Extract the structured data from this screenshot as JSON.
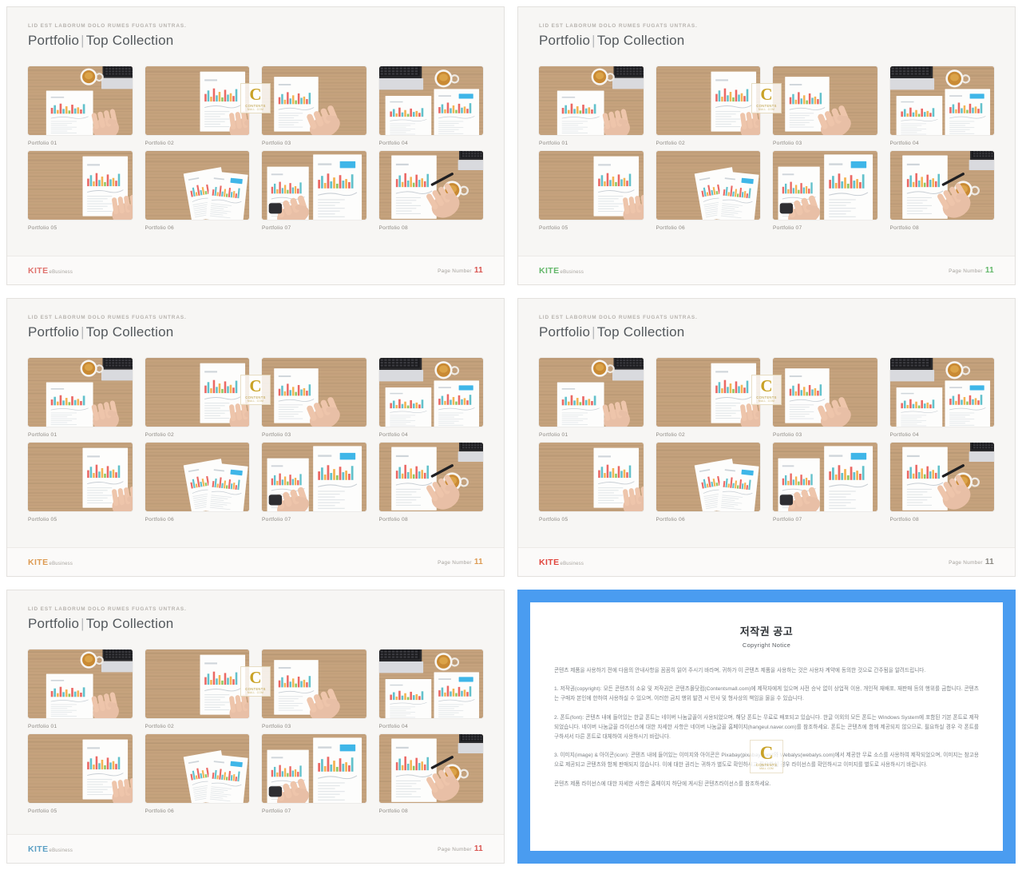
{
  "slides": [
    {
      "eyebrow": "LID EST LABORUM  DOLO RUMES FUGATS  UNTRAS.",
      "title_a": "Portfolio",
      "title_bar": "|",
      "title_b": "Top Collection",
      "logo_main": "KITE",
      "logo_sub": "eBusiness",
      "logo_color": "#e0736e",
      "page_label": "Page Number",
      "page_value": "11",
      "page_value_color": "#d9534f",
      "thumbs": [
        {
          "label": "Portfolio 01",
          "scene": "laptop-coffee-hand"
        },
        {
          "label": "Portfolio 02",
          "scene": "paper-hand-right"
        },
        {
          "label": "Portfolio 03",
          "scene": "paper-hand-point"
        },
        {
          "label": "Portfolio 04",
          "scene": "laptop-coffee-two-docs"
        },
        {
          "label": "Portfolio 05",
          "scene": "paper-hand-right"
        },
        {
          "label": "Portfolio 06",
          "scene": "two-docs-diagonal"
        },
        {
          "label": "Portfolio 07",
          "scene": "hand-watch-two-docs"
        },
        {
          "label": "Portfolio 08",
          "scene": "pen-hand-coffee-laptop"
        }
      ]
    },
    {
      "eyebrow": "LID EST LABORUM  DOLO RUMES FUGATS  UNTRAS.",
      "title_a": "Portfolio",
      "title_bar": "|",
      "title_b": "Top Collection",
      "logo_main": "KITE",
      "logo_sub": "eBusiness",
      "logo_color": "#63b76a",
      "page_label": "Page Number",
      "page_value": "11",
      "page_value_color": "#63b76a",
      "thumbs": [
        {
          "label": "Portfolio 01",
          "scene": "laptop-coffee-hand"
        },
        {
          "label": "Portfolio 02",
          "scene": "paper-hand-right"
        },
        {
          "label": "Portfolio 03",
          "scene": "paper-hand-point"
        },
        {
          "label": "Portfolio 04",
          "scene": "laptop-coffee-two-docs"
        },
        {
          "label": "Portfolio 05",
          "scene": "paper-hand-right"
        },
        {
          "label": "Portfolio 06",
          "scene": "two-docs-diagonal"
        },
        {
          "label": "Portfolio 07",
          "scene": "hand-watch-two-docs"
        },
        {
          "label": "Portfolio 08",
          "scene": "pen-hand-coffee-laptop"
        }
      ]
    },
    {
      "eyebrow": "LID EST LABORUM  DOLO RUMES FUGATS  UNTRAS.",
      "title_a": "Portfolio",
      "title_bar": "|",
      "title_b": "Top Collection",
      "logo_main": "KITE",
      "logo_sub": "eBusiness",
      "logo_color": "#dd9a52",
      "page_label": "Page Number",
      "page_value": "11",
      "page_value_color": "#dd9a52",
      "thumbs": [
        {
          "label": "Portfolio 01",
          "scene": "laptop-coffee-hand"
        },
        {
          "label": "Portfolio 02",
          "scene": "paper-hand-right"
        },
        {
          "label": "Portfolio 03",
          "scene": "paper-hand-point"
        },
        {
          "label": "Portfolio 04",
          "scene": "laptop-coffee-two-docs"
        },
        {
          "label": "Portfolio 05",
          "scene": "paper-hand-right"
        },
        {
          "label": "Portfolio 06",
          "scene": "two-docs-diagonal"
        },
        {
          "label": "Portfolio 07",
          "scene": "hand-watch-two-docs"
        },
        {
          "label": "Portfolio 08",
          "scene": "pen-hand-coffee-laptop"
        }
      ]
    },
    {
      "eyebrow": "LID EST LABORUM  DOLO RUMES FUGATS  UNTRAS.",
      "title_a": "Portfolio",
      "title_bar": "|",
      "title_b": "Top Collection",
      "logo_main": "KITE",
      "logo_sub": "eBusiness",
      "logo_color": "#e0443c",
      "page_label": "Page Number",
      "page_value": "11",
      "page_value_color": "#8a8782",
      "thumbs": [
        {
          "label": "Portfolio 01",
          "scene": "laptop-coffee-hand"
        },
        {
          "label": "Portfolio 02",
          "scene": "paper-hand-right"
        },
        {
          "label": "Portfolio 03",
          "scene": "paper-hand-point"
        },
        {
          "label": "Portfolio 04",
          "scene": "laptop-coffee-two-docs"
        },
        {
          "label": "Portfolio 05",
          "scene": "paper-hand-right"
        },
        {
          "label": "Portfolio 06",
          "scene": "two-docs-diagonal"
        },
        {
          "label": "Portfolio 07",
          "scene": "hand-watch-two-docs"
        },
        {
          "label": "Portfolio 08",
          "scene": "pen-hand-coffee-laptop"
        }
      ]
    },
    {
      "eyebrow": "LID EST LABORUM  DOLO RUMES FUGATS  UNTRAS.",
      "title_a": "Portfolio",
      "title_bar": "|",
      "title_b": "Top Collection",
      "logo_main": "KITE",
      "logo_sub": "eBusiness",
      "logo_color": "#5b9fc4",
      "page_label": "Page Number",
      "page_value": "11",
      "page_value_color": "#d9534f",
      "thumbs": [
        {
          "label": "Portfolio 01",
          "scene": "laptop-coffee-hand"
        },
        {
          "label": "Portfolio 02",
          "scene": "paper-hand-right"
        },
        {
          "label": "Portfolio 03",
          "scene": "paper-hand-point"
        },
        {
          "label": "Portfolio 04",
          "scene": "laptop-coffee-two-docs"
        },
        {
          "label": "Portfolio 05",
          "scene": "paper-hand-right"
        },
        {
          "label": "Portfolio 06",
          "scene": "two-docs-diagonal"
        },
        {
          "label": "Portfolio 07",
          "scene": "hand-watch-two-docs"
        },
        {
          "label": "Portfolio 08",
          "scene": "pen-hand-coffee-laptop"
        }
      ]
    }
  ],
  "watermark": {
    "letter": "C",
    "line1": "CONTENTS",
    "line2": "MALL .COM"
  },
  "copyright": {
    "frame_color": "#4a9cf0",
    "title": "저작권 공고",
    "subtitle": "Copyright Notice",
    "paragraphs": [
      "콘텐츠 제품을 사용하기 전에 다음의 안내사항을 꼼꼼히 읽어 주시기 바라며, 귀하가 이 콘텐츠 제품을 사용하는 것은 사용자 계약에 동의한 것으로 간주됨을 알려드립니다.",
      "1. 저작권(copyright): 모든 콘텐츠의 소유 및 저작권은 콘텐츠몰닷컴(Contentsmall.com)에 제작자에게 있으며 사전 승낙 없이 상업적 이용, 개인적 재배포, 재판매 등의 행위를 금합니다. 콘텐츠는 구매자 본인에 한하여 사용하실 수 있으며, 이러한 금지 행위 발견 시 민사 및 형사상의 책임을 물을 수 있습니다.",
      "2. 폰트(font): 콘텐츠 내에 들어있는 한글 폰트는 네이버 나눔글꼴이 사용되었으며, 해당 폰트는 무료로 배포되고 있습니다. 한글 이외의 모든 폰트는 Windows System에 포함된 기본 폰트로 제작되었습니다. 네이버 나눔글꼴 라이선스에 대한 자세한 사항은 네이버 나눔글꼴 홈페이지(hangeul.naver.com)를 참조하세요. 폰트는 콘텐츠에 함께 제공되지 않으므로, 필요하실 경우 각 폰트를 구하셔서 다른 폰트로 대체하여 사용하시기 바랍니다.",
      "3. 이미지(image) & 아이콘(icon): 콘텐츠 내에 들어있는 이미지와 아이콘은 Pixabay(pixabay.com)와 Webalys(webalys.com)에서 제공한 무료 소스를 사용하여 제작되었으며, 이미지는 참고용으로 제공되고 콘텐츠와 함께 판매되지 않습니다. 이에 대한 권리는 귀하가 별도로 확인하시고 필요하실 경우 라이선스를 확인하시고 이미지를 별도로 사용하시기 바랍니다.",
      "콘텐츠 제품 라이선스에 대한 자세한 사항은 홈페이지 하단에 게시된 콘텐츠라이선스를 참조하세요."
    ]
  }
}
